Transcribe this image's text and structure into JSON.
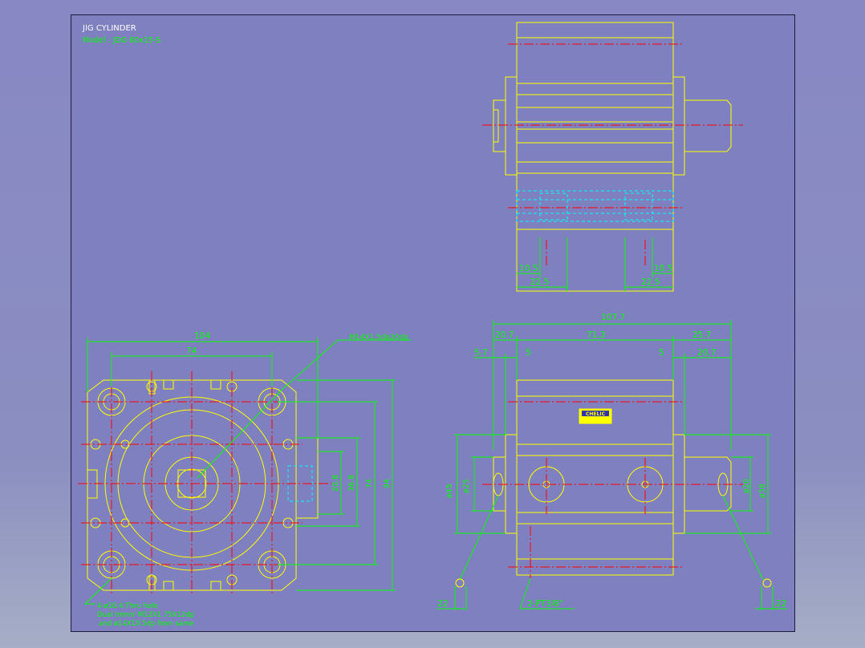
{
  "title": {
    "name": "JIG  CYLINDER",
    "model": "Model : JDG 60x15-S"
  },
  "top_view": {
    "dim_left_inner": "10.5",
    "dim_left_outer": "22.5",
    "dim_right_inner": "10.5",
    "dim_right_outer": "22.5"
  },
  "front_view": {
    "dim_width": "104",
    "dim_hole_pitch": "74",
    "thread_callout": "M14X1.5dp20dp",
    "dim_v1": "20.8",
    "dim_v2": "36.8",
    "dim_v3": "74",
    "dim_v4": "94",
    "note_line1": "4-ø10.4 Thru hole",
    "note_line2": "Dual tmnnr  M12X1.75X12dp",
    "note_line3": "and ø14X10.5dp from same"
  },
  "side_view": {
    "dim_total": "107.7",
    "dim_left": "20.7",
    "dim_mid": "71.3",
    "dim_right": "25.7",
    "dim_5_7": "5.7",
    "dim_5_left": "5",
    "dim_5_right": "5",
    "dim_20_7": "20.7",
    "dim_phi25": "ø25",
    "dim_phi45": "ø45",
    "dim_phi20": "ø20",
    "dim_phi38": "ø38",
    "port_callout": "2-PT3/8\"",
    "dim_22_left": "22",
    "dim_22_right": "22",
    "brand": "CHELIC"
  },
  "colors": {
    "outline": "#ffff00",
    "center": "#ff0000",
    "dimension": "#00ff00",
    "hidden": "#00ffff",
    "text_title": "#ffffff",
    "text_model": "#00ff00"
  }
}
